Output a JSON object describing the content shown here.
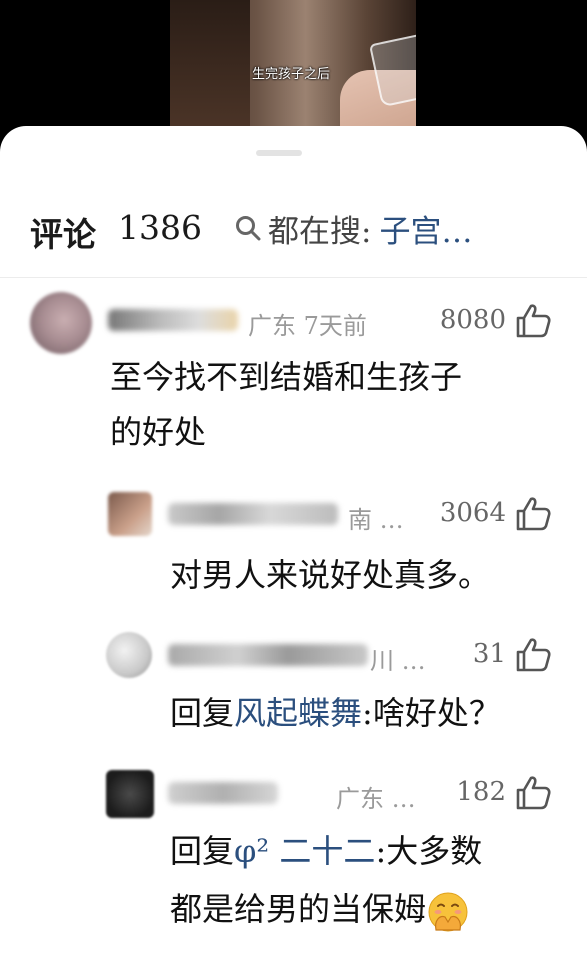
{
  "video": {
    "caption": "生完孩子之后"
  },
  "header": {
    "title": "评论",
    "count": "1386",
    "search_label": "都在搜:",
    "search_term": "子宫…"
  },
  "comments": [
    {
      "region_time": "广东 7天前",
      "likes": "8080",
      "text_lines": [
        "至今找不到结婚和生孩子",
        "的好处"
      ]
    },
    {
      "region_time": "南 …",
      "likes": "3064",
      "text_lines": [
        "对男人来说好处真多。"
      ]
    },
    {
      "region_time": "川 …",
      "likes": "31",
      "reply_prefix": "回复",
      "reply_to": "风起蝶舞",
      "reply_text": ":啥好处？"
    },
    {
      "region_time": "广东 …",
      "likes": "182",
      "reply_prefix": "回复",
      "reply_to": "φ² 二十二",
      "reply_text": ":大多数",
      "text_line2": "都是给男的当保姆"
    }
  ],
  "icons": {
    "search": "search-icon",
    "like": "thumbs-up-icon",
    "emoji": "hands-over-mouth-emoji-icon"
  },
  "colors": {
    "accent_link": "#2b4f7e",
    "meta_gray": "#9a9a9a"
  }
}
